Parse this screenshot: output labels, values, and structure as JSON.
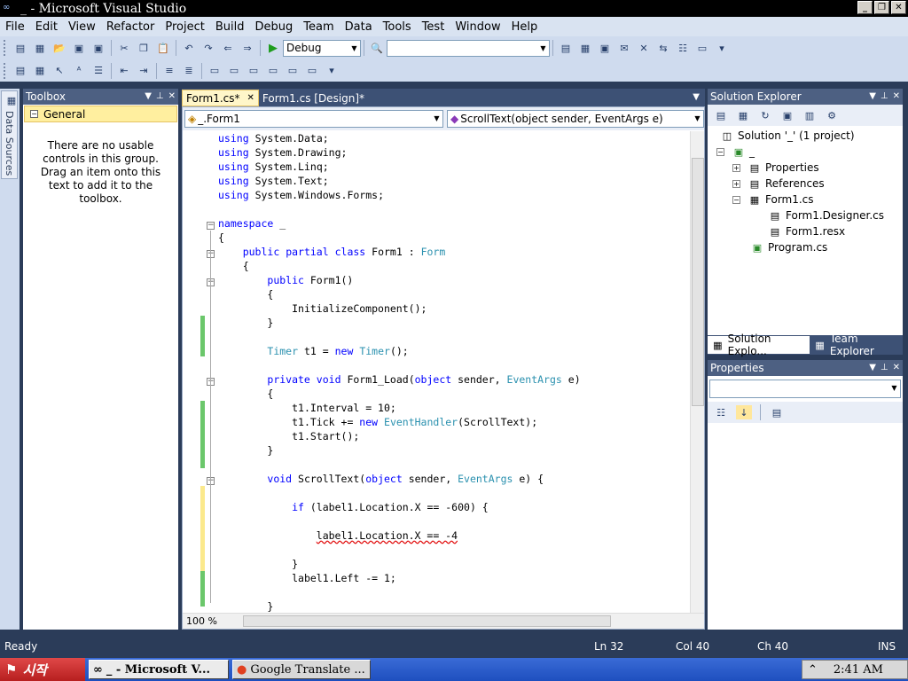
{
  "window": {
    "title": "_ - Microsoft Visual Studio"
  },
  "menu": [
    "File",
    "Edit",
    "View",
    "Refactor",
    "Project",
    "Build",
    "Debug",
    "Team",
    "Data",
    "Tools",
    "Test",
    "Window",
    "Help"
  ],
  "toolbar": {
    "config_value": "Debug",
    "find_value": ""
  },
  "side_tab": {
    "label": "Data Sources"
  },
  "toolbox": {
    "title": "Toolbox",
    "group": "General",
    "empty_text": "There are no usable controls in this group. Drag an item onto this text to add it to the toolbox."
  },
  "editor": {
    "tabs": [
      {
        "label": "Form1.cs*"
      },
      {
        "label": "Form1.cs [Design]*"
      }
    ],
    "nav_left": "_.Form1",
    "nav_right": "ScrollText(object sender, EventArgs e)",
    "zoom": "100 %",
    "lines": [
      "using System.Data;",
      "using System.Drawing;",
      "using System.Linq;",
      "using System.Text;",
      "using System.Windows.Forms;",
      "",
      "namespace _",
      "{",
      "    public partial class Form1 : Form",
      "    {",
      "        public Form1()",
      "        {",
      "            InitializeComponent();",
      "        }",
      "",
      "        Timer t1 = new Timer();",
      "",
      "        private void Form1_Load(object sender, EventArgs e)",
      "        {",
      "            t1.Interval = 10;",
      "            t1.Tick += new EventHandler(ScrollText);",
      "            t1.Start();",
      "        }",
      "",
      "        void ScrollText(object sender, EventArgs e) {",
      "",
      "            if (label1.Location.X == -600) {",
      "",
      "                label1.Location.X == -4",
      "",
      "            }",
      "            label1.Left -= 1;",
      "",
      "        }"
    ]
  },
  "solution_explorer": {
    "title": "Solution Explorer",
    "solution": "Solution '_' (1 project)",
    "project": "_",
    "items": [
      "Properties",
      "References",
      "Form1.cs",
      "Form1.Designer.cs",
      "Form1.resx",
      "Program.cs"
    ],
    "tab_active": "Solution Explo...",
    "tab_other": "Team Explorer"
  },
  "properties": {
    "title": "Properties"
  },
  "status": {
    "ready": "Ready",
    "ln": "Ln 32",
    "col": "Col 40",
    "ch": "Ch 40",
    "mode": "INS"
  },
  "taskbar": {
    "start": "시작",
    "tasks": [
      "_ - Microsoft V...",
      "Google Translate ..."
    ],
    "time": "2:41 AM"
  },
  "colors": {
    "keyword": "#0000ff",
    "type": "#2b91af",
    "panel_header": "#4d6082"
  }
}
